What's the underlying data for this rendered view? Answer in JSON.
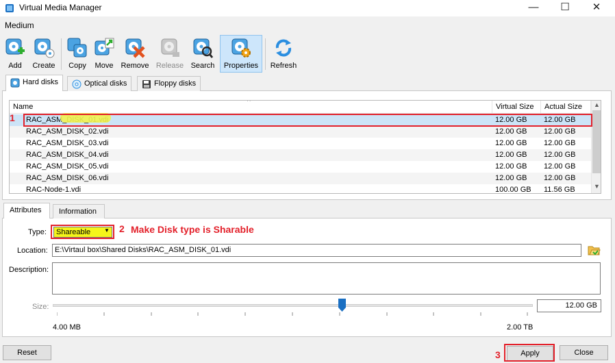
{
  "window": {
    "title": "Virtual Media Manager",
    "controls": {
      "minimize": "—",
      "maximize": "☐",
      "close": "✕"
    }
  },
  "menu": {
    "medium": "Medium"
  },
  "toolbar": {
    "items": [
      {
        "label": "Add",
        "icon": "add-disk-icon"
      },
      {
        "label": "Create",
        "icon": "create-disk-icon"
      },
      {
        "label": "Copy",
        "icon": "copy-disk-icon"
      },
      {
        "label": "Move",
        "icon": "move-disk-icon"
      },
      {
        "label": "Remove",
        "icon": "remove-disk-icon"
      },
      {
        "label": "Release",
        "icon": "release-disk-icon",
        "disabled": true
      },
      {
        "label": "Search",
        "icon": "search-disk-icon"
      },
      {
        "label": "Properties",
        "icon": "properties-disk-icon",
        "active": true
      },
      {
        "label": "Refresh",
        "icon": "refresh-icon"
      }
    ]
  },
  "media_tabs": [
    {
      "label": "Hard disks",
      "active": true
    },
    {
      "label": "Optical disks"
    },
    {
      "label": "Floppy disks"
    }
  ],
  "disk_table": {
    "headers": {
      "name": "Name",
      "virtual": "Virtual Size",
      "actual": "Actual Size"
    },
    "sort_indicator": "^",
    "rows": [
      {
        "name": "RAC_ASM_DISK_01.vdi",
        "virtual": "12.00 GB",
        "actual": "12.00 GB"
      },
      {
        "name": "RAC_ASM_DISK_02.vdi",
        "virtual": "12.00 GB",
        "actual": "12.00 GB"
      },
      {
        "name": "RAC_ASM_DISK_03.vdi",
        "virtual": "12.00 GB",
        "actual": "12.00 GB"
      },
      {
        "name": "RAC_ASM_DISK_04.vdi",
        "virtual": "12.00 GB",
        "actual": "12.00 GB"
      },
      {
        "name": "RAC_ASM_DISK_05.vdi",
        "virtual": "12.00 GB",
        "actual": "12.00 GB"
      },
      {
        "name": "RAC_ASM_DISK_06.vdi",
        "virtual": "12.00 GB",
        "actual": "12.00 GB"
      },
      {
        "name": "RAC-Node-1.vdi",
        "virtual": "100.00 GB",
        "actual": "11.56 GB"
      }
    ]
  },
  "detail_tabs": [
    {
      "label": "Attributes",
      "active": true
    },
    {
      "label": "Information"
    }
  ],
  "attributes": {
    "type_label": "Type:",
    "type_value": "Shareable",
    "location_label": "Location:",
    "location_value": "E:\\Virtaul box\\Shared Disks\\RAC_ASM_DISK_01.vdi",
    "description_label": "Description:",
    "description_value": "",
    "size_label": "Size:",
    "size_value": "12.00 GB",
    "size_min": "4.00 MB",
    "size_max": "2.00 TB"
  },
  "buttons": {
    "reset": "Reset",
    "apply": "Apply",
    "close": "Close"
  },
  "annotations": {
    "step1": "1",
    "step2": "2",
    "step2_text": "Make Disk type is Sharable",
    "step3": "3"
  },
  "colors": {
    "annotation_red": "#e3202a",
    "highlight_yellow": "#f5f51a",
    "selection_blue": "#cce4f7"
  }
}
